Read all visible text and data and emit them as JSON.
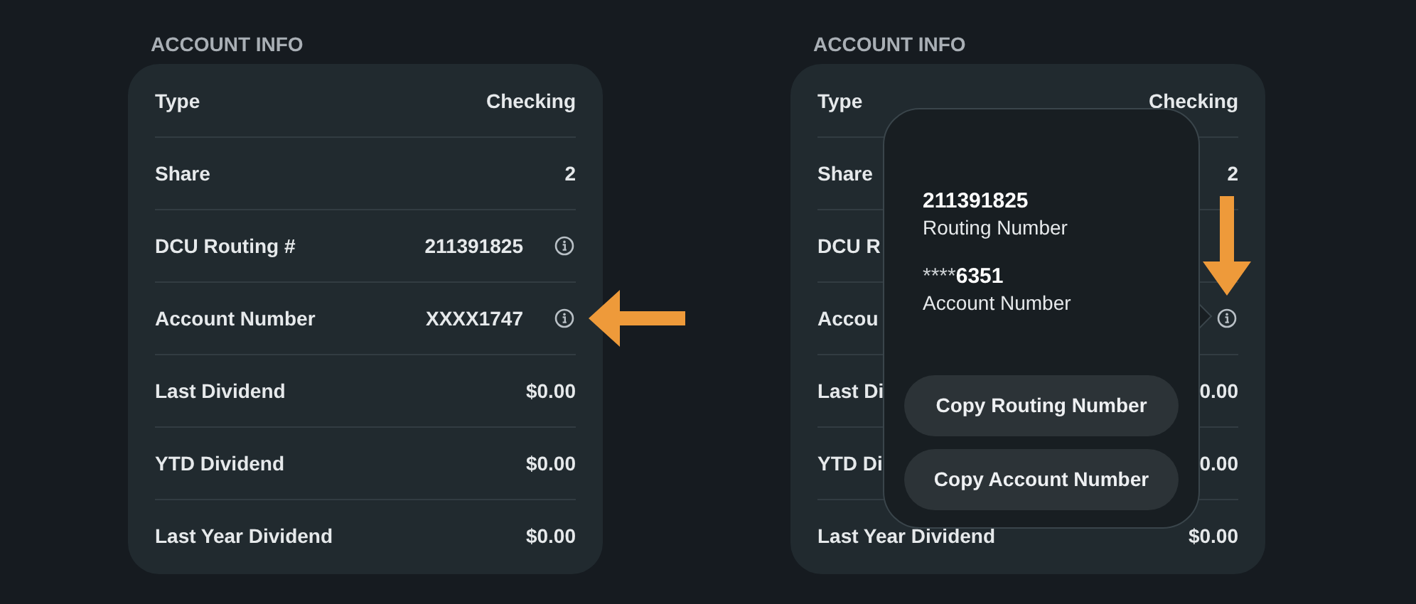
{
  "panels": [
    {
      "heading": "ACCOUNT INFO",
      "rows": [
        {
          "label": "Type",
          "value": "Checking",
          "info_icon": false,
          "pointer": false
        },
        {
          "label": "Share",
          "value": "2",
          "info_icon": false,
          "pointer": false
        },
        {
          "label": "DCU Routing #",
          "value": "211391825",
          "info_icon": true,
          "pointer": false
        },
        {
          "label": "Account Number",
          "value": "XXXX1747",
          "info_icon": true,
          "pointer": true
        },
        {
          "label": "Last Dividend",
          "value": "$0.00",
          "info_icon": false,
          "pointer": false
        },
        {
          "label": "YTD Dividend",
          "value": "$0.00",
          "info_icon": false,
          "pointer": false
        },
        {
          "label": "Last Year Dividend",
          "value": "$0.00",
          "info_icon": false,
          "pointer": false
        }
      ]
    },
    {
      "heading": "ACCOUNT INFO",
      "rows": [
        {
          "label": "Type",
          "value": "Checking",
          "info_icon": false,
          "pointer": false
        },
        {
          "label": "Share",
          "value": "2",
          "info_icon": false,
          "pointer": false
        },
        {
          "label": "DCU R",
          "info_icon": false,
          "pointer": false
        },
        {
          "label": "Accou",
          "info_icon": true,
          "pointer": true
        },
        {
          "label": "Last Di",
          "value": "0.00",
          "info_icon": false,
          "pointer": false
        },
        {
          "label": "YTD Di",
          "value": "0.00",
          "info_icon": false,
          "pointer": false
        },
        {
          "label": "Last Year Dividend",
          "value": "$0.00",
          "info_icon": false,
          "pointer": false
        }
      ],
      "popover": {
        "items": [
          {
            "digits": "211391825",
            "caption": "Routing Number"
          },
          {
            "mask": "****",
            "digits": "6351",
            "caption": "Account Number"
          }
        ],
        "buttons": [
          "Copy Routing Number",
          "Copy Account Number"
        ]
      }
    }
  ]
}
